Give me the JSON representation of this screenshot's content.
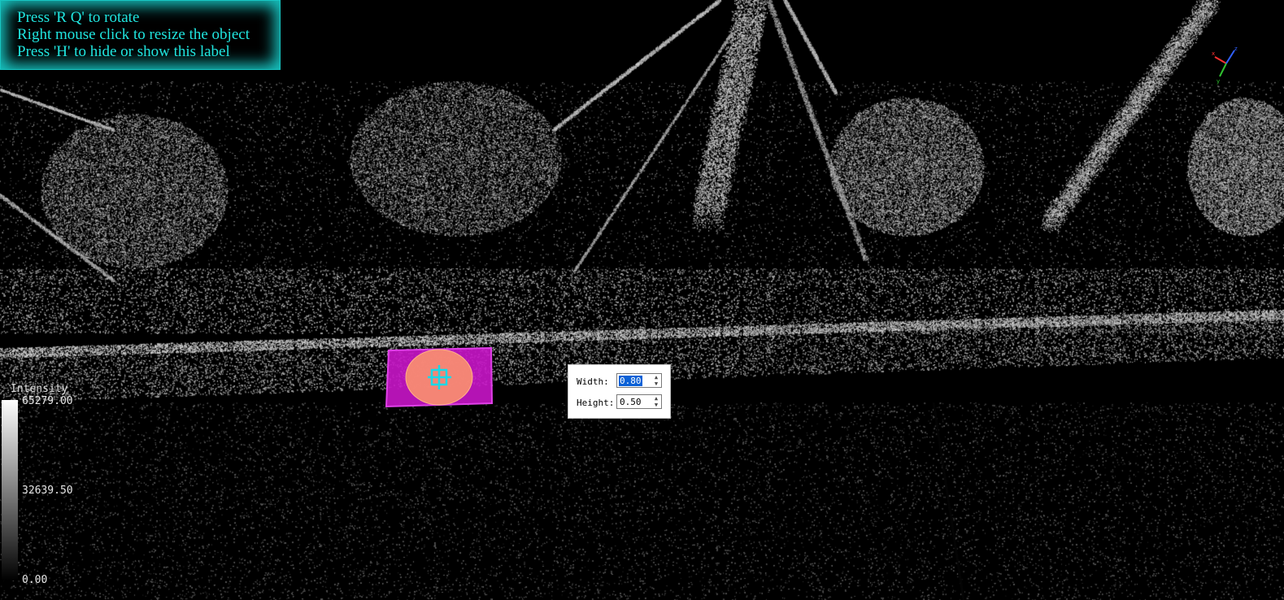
{
  "help_label": {
    "lines": [
      "Press 'R Q' to rotate",
      "Right mouse click to resize the object",
      "Press 'H' to hide or show this label"
    ]
  },
  "colorbar": {
    "title": "Intensity",
    "max_label": "65279.00",
    "mid_label": "32639.50",
    "min_label": "0.00"
  },
  "resize_dialog": {
    "width_label": "Width:",
    "width_value": "0.80",
    "height_label": "Height:",
    "height_value": "0.50"
  },
  "selection_object": {
    "icon": "move-crosshair-icon",
    "fill_color": "#c815c8",
    "ellipse_color": "#ff9a6a",
    "crosshair_color": "#19d8e6"
  },
  "axis_widget": {
    "icon": "xyz-axes-icon",
    "x_color": "#ff3030",
    "y_color": "#30c030",
    "z_color": "#3060ff"
  },
  "colors": {
    "label_text": "#20e6e0",
    "label_glow": "#17c6c3",
    "background": "#000000"
  }
}
